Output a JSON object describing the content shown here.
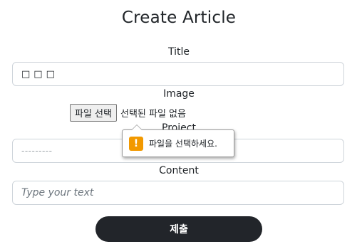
{
  "page": {
    "title": "Create Article"
  },
  "form": {
    "title_label": "Title",
    "title_value": "□□□",
    "image_label": "Image",
    "file_button": "파일 선택",
    "file_status": "선택된 파일 없음",
    "project_label": "Project",
    "project_value": "---------",
    "content_label": "Content",
    "content_placeholder": "Type your text",
    "submit_label": "제출"
  },
  "tooltip": {
    "icon": "warning-icon",
    "icon_glyph": "!",
    "message": "파일을 선택하세요."
  },
  "colors": {
    "submit_bg": "#22252a",
    "warning": "#f29900"
  }
}
